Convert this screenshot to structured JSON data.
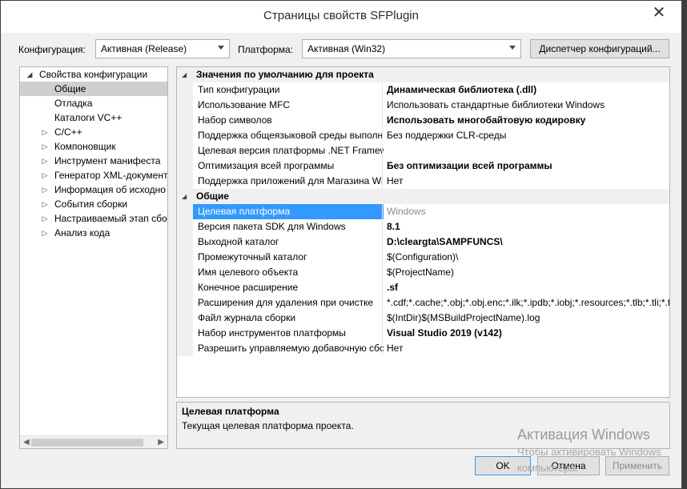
{
  "window": {
    "title": "Страницы свойств SFPlugin",
    "close_glyph": "✕"
  },
  "toolbar": {
    "config_label": "Конфигурация:",
    "config_value": "Активная (Release)",
    "platform_label": "Платформа:",
    "platform_value": "Активная (Win32)",
    "config_manager_label": "Диспетчер конфигураций..."
  },
  "tree": {
    "root": "Свойства конфигурации",
    "items": [
      {
        "label": "Общие",
        "selected": true
      },
      {
        "label": "Отладка"
      },
      {
        "label": "Каталоги VC++"
      },
      {
        "label": "C/C++"
      },
      {
        "label": "Компоновщик"
      },
      {
        "label": "Инструмент манифеста"
      },
      {
        "label": "Генератор XML-документ"
      },
      {
        "label": "Информация об исходно"
      },
      {
        "label": "События сборки"
      },
      {
        "label": "Настраиваемый этап сбо"
      },
      {
        "label": "Анализ кода"
      }
    ]
  },
  "grid": {
    "defaults_category": "Значения по умолчанию для проекта",
    "defaults_rows": [
      {
        "name": "Тип конфигурации",
        "value": "Динамическая библиотека (.dll)"
      },
      {
        "name": "Использование MFC",
        "value": "Использовать стандартные библиотеки Windows"
      },
      {
        "name": "Набор символов",
        "value": "Использовать многобайтовую кодировку"
      },
      {
        "name": "Поддержка общеязыковой среды выполн",
        "value": "Без поддержки CLR-среды"
      },
      {
        "name": "Целевая версия платформы .NET Framew",
        "value": ""
      },
      {
        "name": "Оптимизация всей программы",
        "value": "Без оптимизации всей программы"
      },
      {
        "name": "Поддержка приложений для Магазина Wi",
        "value": "Нет"
      }
    ],
    "general_category": "Общие",
    "general_rows": [
      {
        "name": "Целевая платформа",
        "value": "Windows"
      },
      {
        "name": "Версия пакета SDK для Windows",
        "value": "8.1"
      },
      {
        "name": "Выходной каталог",
        "value": "D:\\cleargta\\SAMPFUNCS\\"
      },
      {
        "name": "Промежуточный каталог",
        "value": "$(Configuration)\\"
      },
      {
        "name": "Имя целевого объекта",
        "value": "$(ProjectName)"
      },
      {
        "name": "Конечное расширение",
        "value": ".sf"
      },
      {
        "name": "Расширения для удаления при очистке",
        "value": "*.cdf;*.cache;*.obj;*.obj.enc;*.ilk;*.ipdb;*.iobj;*.resources;*.tlb;*.tli;*.t"
      },
      {
        "name": "Файл журнала сборки",
        "value": "$(IntDir)$(MSBuildProjectName).log"
      },
      {
        "name": "Набор инструментов платформы",
        "value": "Visual Studio 2019 (v142)"
      },
      {
        "name": "Разрешить управляемую добавочную сбс",
        "value": "Нет"
      }
    ]
  },
  "description": {
    "title": "Целевая платформа",
    "text": "Текущая целевая платформа проекта."
  },
  "buttons": {
    "ok": "OK",
    "cancel": "Отмена",
    "apply": "Применить"
  },
  "watermark": {
    "line1": "Активация Windows",
    "line2": "Чтобы активировать Windows",
    "line3": "компьютера."
  }
}
